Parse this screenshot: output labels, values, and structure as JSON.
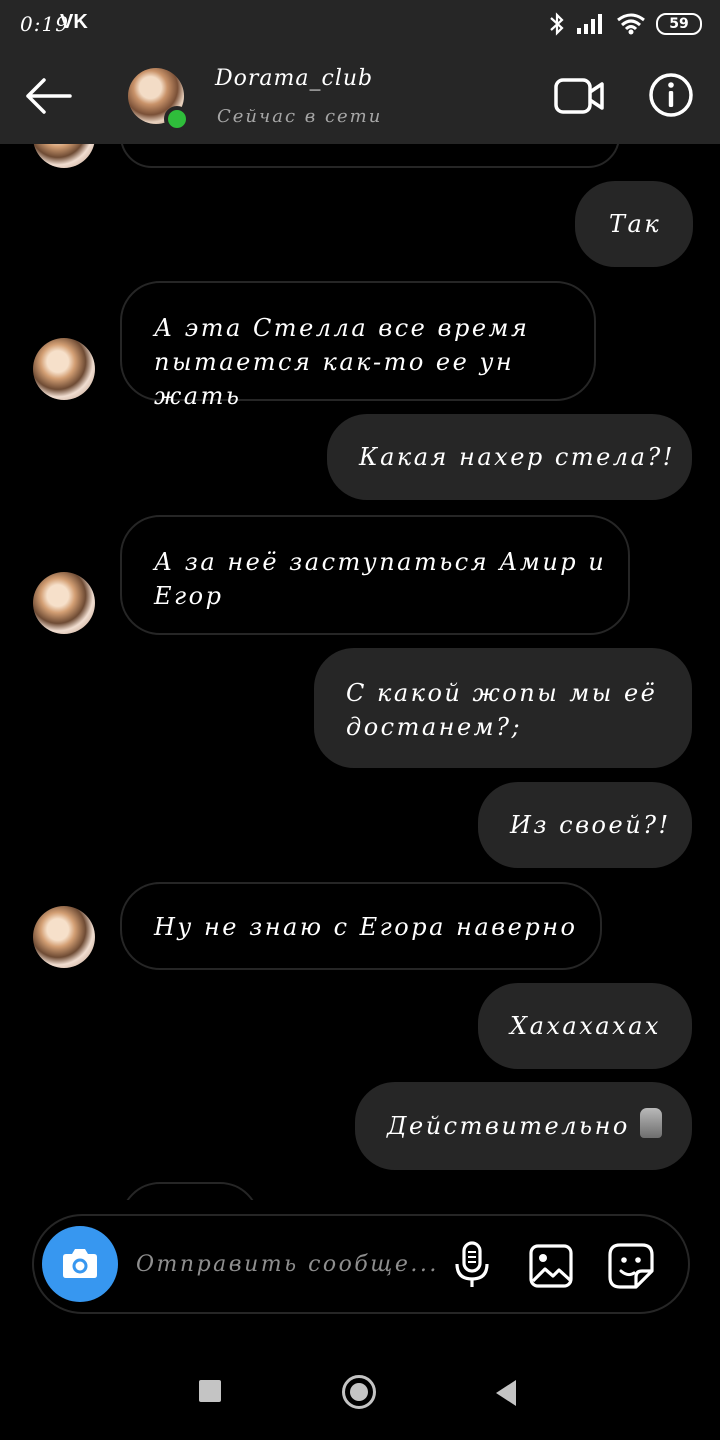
{
  "status_bar": {
    "time": "0:19",
    "app_icon": "vk-icon",
    "battery": "59"
  },
  "header": {
    "back_icon": "arrow-left-icon",
    "contact_name": "Dorama_club",
    "contact_status": "Сейчас в сети",
    "video_icon": "video-camera-icon",
    "info_icon": "info-icon"
  },
  "messages": [
    {
      "side": "out",
      "text": "Так"
    },
    {
      "side": "in",
      "line1": "А эта Стелла все время",
      "line2": "пытается как-то ее ун жать"
    },
    {
      "side": "out",
      "text": "Какая нахер стела?!"
    },
    {
      "side": "in",
      "line1": "А за неё заступаться Амир и",
      "line2": "Егор"
    },
    {
      "side": "out",
      "line1": "С какой жопы мы её",
      "line2": "достанем?;"
    },
    {
      "side": "out",
      "text": "Из своей?!"
    },
    {
      "side": "in",
      "text": "Ну не знаю с Егора наверно"
    },
    {
      "side": "out",
      "text": "Хахахахах"
    },
    {
      "side": "out",
      "text": "Действительно",
      "emoji": "moai-emoji-icon"
    }
  ],
  "composer": {
    "camera_icon": "camera-icon",
    "placeholder": "Отправить сообще...",
    "mic_icon": "microphone-icon",
    "gallery_icon": "gallery-icon",
    "sticker_icon": "sticker-icon"
  },
  "colors": {
    "bar_background": "#262626",
    "incoming_border": "#262626",
    "outgoing_bubble": "#262626",
    "online": "#2fbd3b",
    "camera_button": "#3797f0"
  }
}
